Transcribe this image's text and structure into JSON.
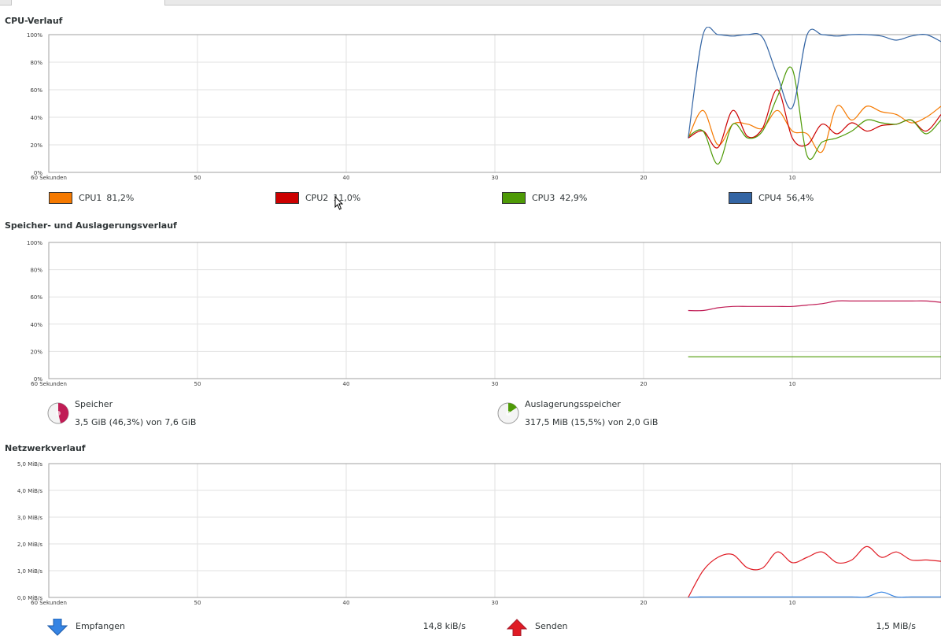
{
  "cpu": {
    "title": "CPU-Verlauf",
    "legend": [
      {
        "label": "CPU1",
        "value": "81,2%",
        "color": "#f57900"
      },
      {
        "label": "CPU2",
        "value": "11,0%",
        "color": "#cc0000"
      },
      {
        "label": "CPU3",
        "value": "42,9%",
        "color": "#4e9a06"
      },
      {
        "label": "CPU4",
        "value": "56,4%",
        "color": "#3465a4"
      }
    ]
  },
  "memory": {
    "title": "Speicher- und Auslagerungsverlauf",
    "ram": {
      "label": "Speicher",
      "detail": "3,5 GiB (46,3%) von 7,6 GiB",
      "color": "#c01c55",
      "fraction": 0.463
    },
    "swap": {
      "label": "Auslagerungsspeicher",
      "detail": "317,5 MiB (15,5%) von 2,0 GiB",
      "color": "#4e9a06",
      "fraction": 0.155
    }
  },
  "network": {
    "title": "Netzwerkverlauf",
    "receive": {
      "label": "Empfangen",
      "rate": "14,8 kiB/s",
      "color": "#3584e4"
    },
    "send": {
      "label": "Senden",
      "rate": "1,5 MiB/s",
      "color": "#e01b24"
    }
  },
  "x_ticks": [
    "60 Sekunden",
    "50",
    "40",
    "30",
    "20",
    "10"
  ],
  "percent_ticks": [
    "100%",
    "80%",
    "60%",
    "40%",
    "20%",
    "0%"
  ],
  "network_ticks": [
    "5,0 MiB/s",
    "4,0 MiB/s",
    "3,0 MiB/s",
    "2,0 MiB/s",
    "1,0 MiB/s",
    "0,0 MiB/s"
  ],
  "chart_data": [
    {
      "type": "line",
      "title": "CPU-Verlauf",
      "x_unit": "seconds ago",
      "xlim": [
        60,
        0
      ],
      "ylim": [
        0,
        100
      ],
      "x_ticks": [
        "60 Sekunden",
        "50",
        "40",
        "30",
        "20",
        "10"
      ],
      "y_ticks": [
        "100%",
        "80%",
        "60%",
        "40%",
        "20%",
        "0%"
      ],
      "grid": true,
      "x": [
        17,
        16,
        15,
        14,
        13,
        12,
        11,
        10,
        9,
        8,
        7,
        6,
        5,
        4,
        3,
        2,
        1,
        0
      ],
      "series": [
        {
          "name": "CPU1",
          "color": "#f57900",
          "values": [
            25,
            45,
            20,
            35,
            35,
            32,
            45,
            30,
            28,
            15,
            48,
            38,
            48,
            44,
            42,
            36,
            40,
            48
          ]
        },
        {
          "name": "CPU2",
          "color": "#cc0000",
          "values": [
            25,
            30,
            18,
            45,
            26,
            32,
            60,
            25,
            20,
            35,
            28,
            36,
            30,
            34,
            35,
            38,
            30,
            42
          ]
        },
        {
          "name": "CPU3",
          "color": "#4e9a06",
          "values": [
            26,
            30,
            6,
            35,
            25,
            30,
            55,
            75,
            12,
            22,
            25,
            30,
            38,
            36,
            35,
            38,
            28,
            38
          ]
        },
        {
          "name": "CPU4",
          "color": "#3465a4",
          "values": [
            25,
            100,
            100,
            99,
            100,
            98,
            70,
            47,
            100,
            100,
            99,
            100,
            100,
            99,
            96,
            99,
            100,
            95
          ]
        }
      ]
    },
    {
      "type": "line",
      "title": "Speicher- und Auslagerungsverlauf",
      "x_unit": "seconds ago",
      "xlim": [
        60,
        0
      ],
      "ylim": [
        0,
        100
      ],
      "x_ticks": [
        "60 Sekunden",
        "50",
        "40",
        "30",
        "20",
        "10"
      ],
      "y_ticks": [
        "100%",
        "80%",
        "60%",
        "40%",
        "20%",
        "0%"
      ],
      "grid": true,
      "x": [
        17,
        16,
        15,
        14,
        13,
        12,
        11,
        10,
        9,
        8,
        7,
        6,
        5,
        4,
        3,
        2,
        1,
        0
      ],
      "series": [
        {
          "name": "Speicher",
          "color": "#c01c55",
          "values": [
            50,
            50,
            52,
            53,
            53,
            53,
            53,
            53,
            54,
            55,
            57,
            57,
            57,
            57,
            57,
            57,
            57,
            56
          ]
        },
        {
          "name": "Auslagerungsspeicher",
          "color": "#4e9a06",
          "values": [
            16,
            16,
            16,
            16,
            16,
            16,
            16,
            16,
            16,
            16,
            16,
            16,
            16,
            16,
            16,
            16,
            16,
            16
          ]
        }
      ]
    },
    {
      "type": "line",
      "title": "Netzwerkverlauf",
      "x_unit": "seconds ago",
      "xlim": [
        60,
        0
      ],
      "ylim": [
        0,
        5
      ],
      "x_ticks": [
        "60 Sekunden",
        "50",
        "40",
        "30",
        "20",
        "10"
      ],
      "y_ticks": [
        "5,0 MiB/s",
        "4,0 MiB/s",
        "3,0 MiB/s",
        "2,0 MiB/s",
        "1,0 MiB/s",
        "0,0 MiB/s"
      ],
      "grid": true,
      "x": [
        17,
        16,
        15,
        14,
        13,
        12,
        11,
        10,
        9,
        8,
        7,
        6,
        5,
        4,
        3,
        2,
        1,
        0
      ],
      "series": [
        {
          "name": "Empfangen",
          "color": "#3584e4",
          "values": [
            0.01,
            0.02,
            0.02,
            0.02,
            0.02,
            0.02,
            0.02,
            0.02,
            0.02,
            0.02,
            0.02,
            0.02,
            0.02,
            0.2,
            0.02,
            0.02,
            0.02,
            0.02
          ]
        },
        {
          "name": "Senden",
          "color": "#e01b24",
          "values": [
            0,
            1.0,
            1.5,
            1.6,
            1.1,
            1.1,
            1.7,
            1.3,
            1.5,
            1.7,
            1.3,
            1.4,
            1.9,
            1.5,
            1.7,
            1.4,
            1.4,
            1.35
          ]
        }
      ]
    }
  ]
}
